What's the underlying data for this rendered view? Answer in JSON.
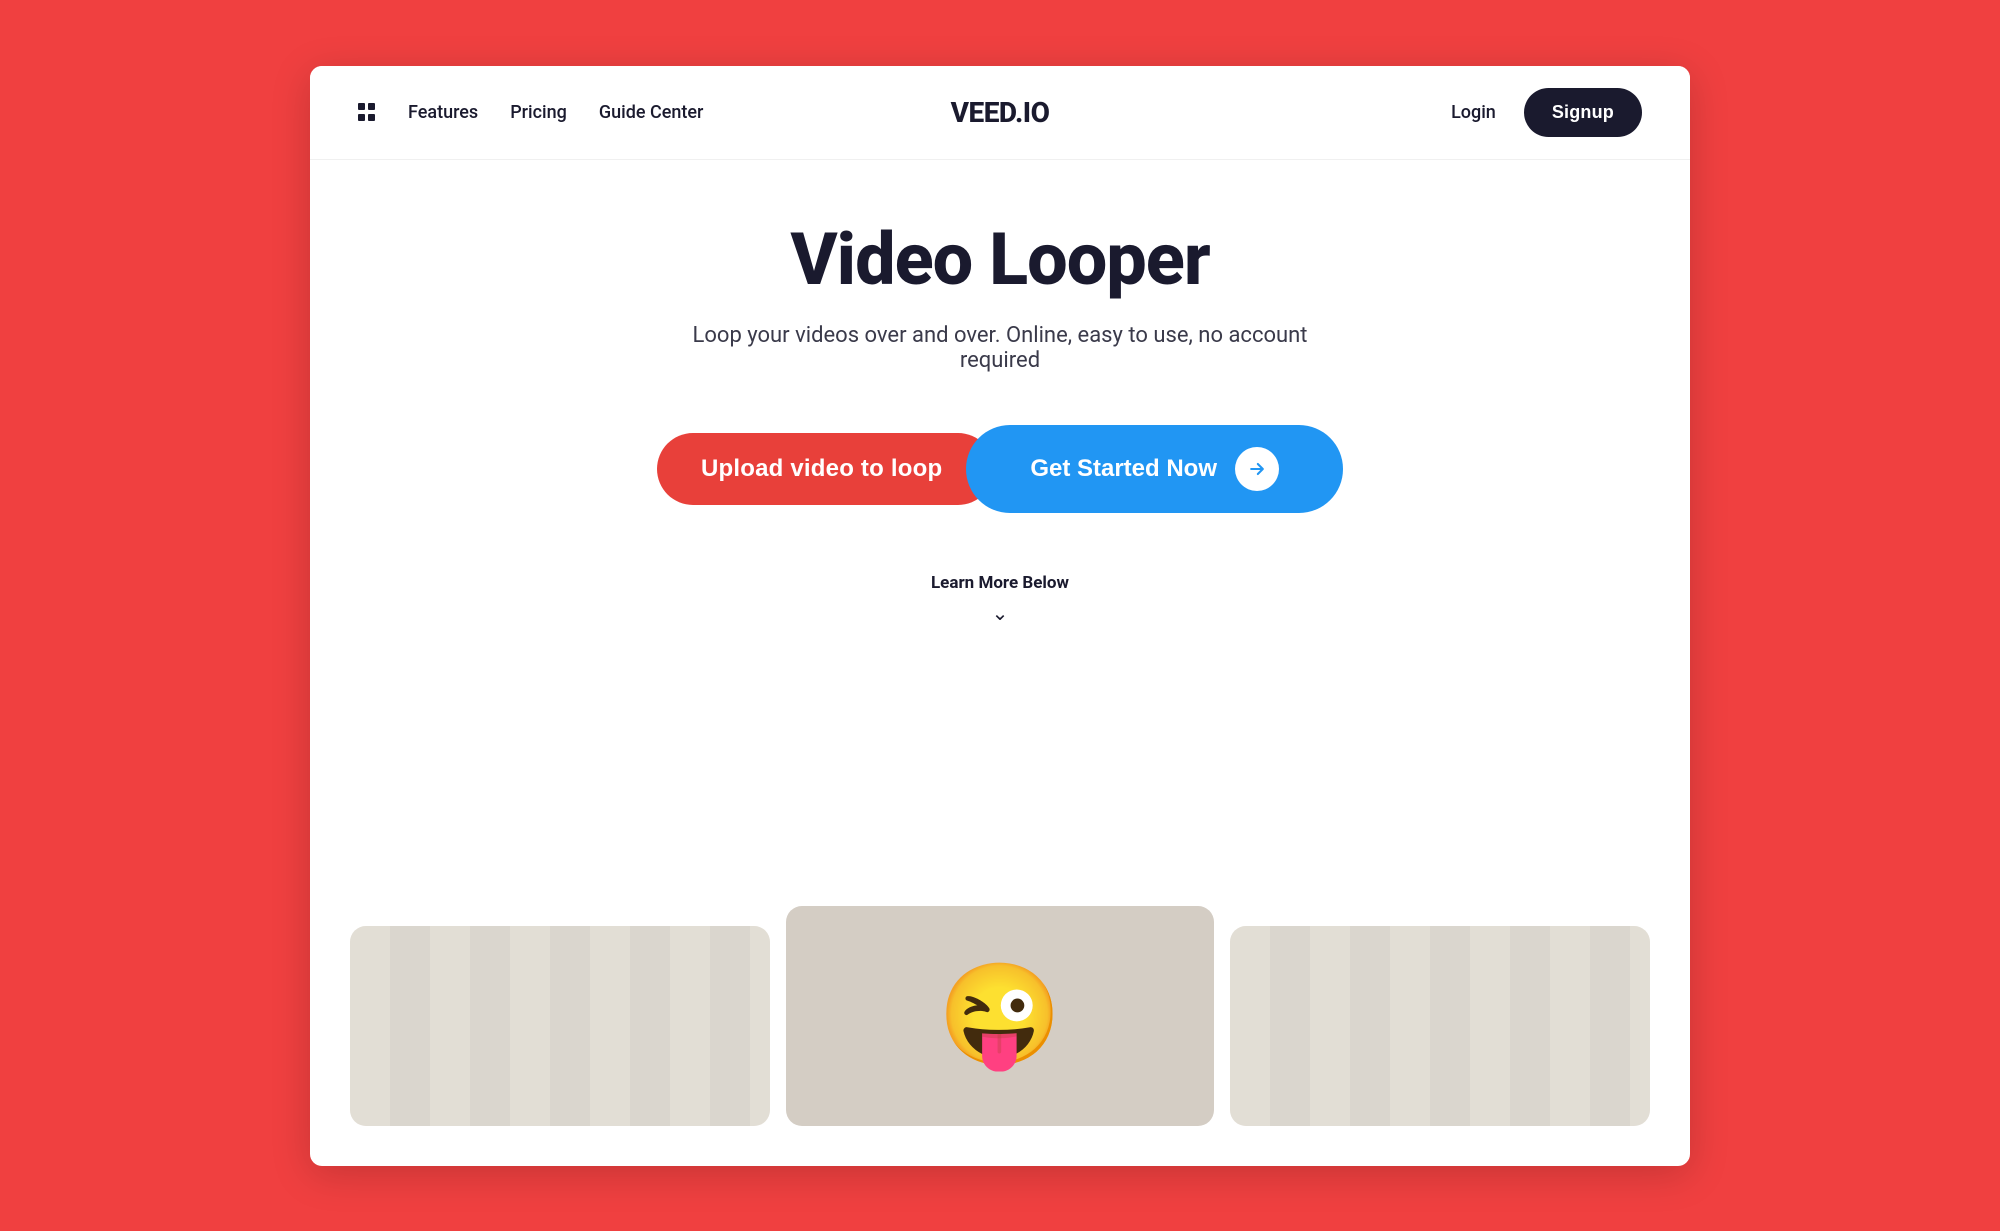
{
  "meta": {
    "bg_color": "#f04040",
    "accent_blue": "#2196f3",
    "accent_red": "#e8403a",
    "dark": "#1a1a2e"
  },
  "navbar": {
    "features_icon": "grid-icon",
    "features_label": "Features",
    "pricing_label": "Pricing",
    "guide_label": "Guide Center",
    "logo": "VEED.IO",
    "login_label": "Login",
    "signup_label": "Signup"
  },
  "hero": {
    "title": "Video Looper",
    "subtitle": "Loop your videos over and over. Online, easy to use, no account required",
    "upload_button": "Upload video to loop",
    "get_started_button": "Get Started Now",
    "learn_more_label": "Learn More Below"
  },
  "preview": {
    "cards": [
      {
        "id": "left",
        "type": "stripes"
      },
      {
        "id": "center",
        "type": "emoji"
      },
      {
        "id": "right",
        "type": "stripes"
      }
    ]
  }
}
